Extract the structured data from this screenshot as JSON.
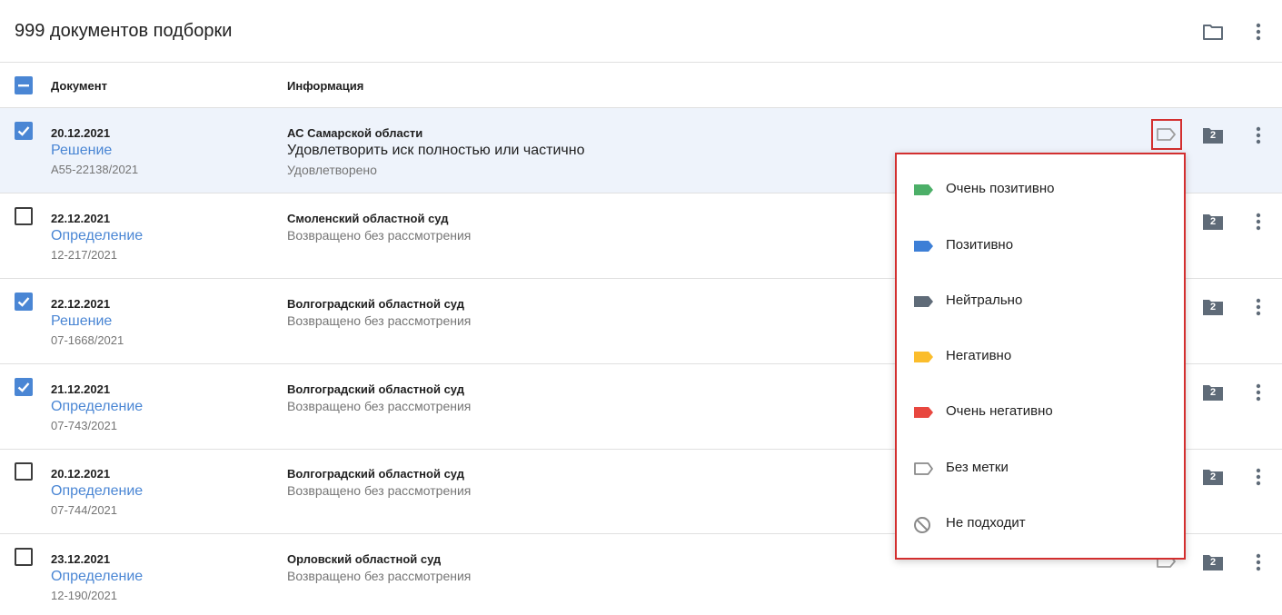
{
  "header": {
    "title": "999 документов подборки",
    "folder_icon": "folder-icon",
    "more_icon": "more-vertical-icon"
  },
  "columns": {
    "document": "Документ",
    "info": "Информация"
  },
  "colors": {
    "accent": "#4a86d4",
    "highlight_border": "#d32f2f",
    "selected_row": "#eef3fb"
  },
  "rows": [
    {
      "checked": true,
      "date": "20.12.2021",
      "type": "Решение",
      "number": "А55-22138/2021",
      "court": "АС Самарской области",
      "main": "Удовлетворить иск полностью или частично",
      "status": "Удовлетворено",
      "folder_count": "2"
    },
    {
      "checked": false,
      "date": "22.12.2021",
      "type": "Определение",
      "number": "12-217/2021",
      "court": "Смоленский областной суд",
      "main": "",
      "status": "Возвращено без рассмотрения",
      "folder_count": "2"
    },
    {
      "checked": true,
      "date": "22.12.2021",
      "type": "Решение",
      "number": "07-1668/2021",
      "court": "Волгоградский областной суд",
      "main": "",
      "status": "Возвращено без рассмотрения",
      "folder_count": "2"
    },
    {
      "checked": true,
      "date": "21.12.2021",
      "type": "Определение",
      "number": "07-743/2021",
      "court": "Волгоградский областной суд",
      "main": "",
      "status": "Возвращено без рассмотрения",
      "folder_count": "2"
    },
    {
      "checked": false,
      "date": "20.12.2021",
      "type": "Определение",
      "number": "07-744/2021",
      "court": "Волгоградский областной суд",
      "main": "",
      "status": "Возвращено без рассмотрения",
      "folder_count": "2"
    },
    {
      "checked": false,
      "date": "23.12.2021",
      "type": "Определение",
      "number": "12-190/2021",
      "court": "Орловский областной суд",
      "main": "",
      "status": "Возвращено без рассмотрения",
      "folder_count": "2"
    }
  ],
  "tag_menu": {
    "items": [
      {
        "label": "Очень позитивно",
        "color": "#4caf68",
        "icon": "tag-filled-icon"
      },
      {
        "label": "Позитивно",
        "color": "#3d7fd6",
        "icon": "tag-filled-icon"
      },
      {
        "label": "Нейтрально",
        "color": "#5f6b78",
        "icon": "tag-filled-icon"
      },
      {
        "label": "Негативно",
        "color": "#fbbd2c",
        "icon": "tag-filled-icon"
      },
      {
        "label": "Очень негативно",
        "color": "#e8473f",
        "icon": "tag-filled-icon"
      },
      {
        "label": "Без метки",
        "color": "#8a8a8a",
        "icon": "tag-outline-icon"
      },
      {
        "label": "Не подходит",
        "color": "#8a8a8a",
        "icon": "block-icon"
      }
    ]
  }
}
